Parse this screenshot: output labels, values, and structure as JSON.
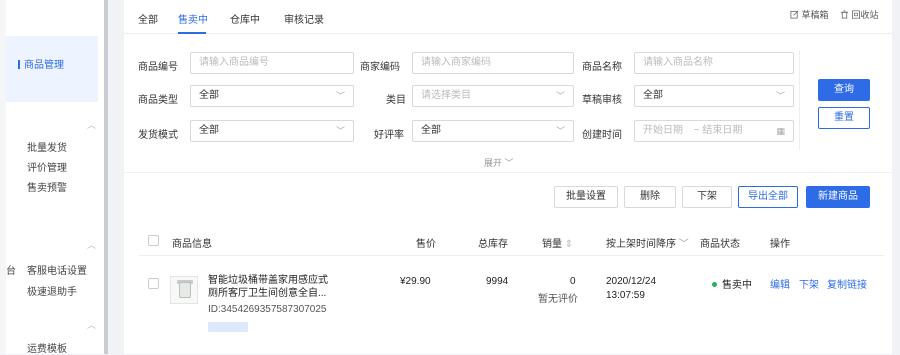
{
  "sidebar": {
    "active_item": "商品管理",
    "group2": [
      "批量发货",
      "评价管理",
      "售卖预警"
    ],
    "group3_cut": "台",
    "group3": [
      "客服电话设置",
      "极速退助手"
    ],
    "group4": [
      "运费模板"
    ]
  },
  "tabs": [
    "全部",
    "售卖中",
    "仓库中",
    "审核记录"
  ],
  "toolbar": {
    "drafts": "草稿箱",
    "recycle": "回收站"
  },
  "filters": {
    "product_code": {
      "label": "商品编号",
      "placeholder": "请输入商品编号"
    },
    "merchant_code": {
      "label": "商家编码",
      "placeholder": "请输入商家编码"
    },
    "product_name": {
      "label": "商品名称",
      "placeholder": "请输入商品名称"
    },
    "product_type": {
      "label": "商品类型",
      "value": "全部"
    },
    "category": {
      "label": "类目",
      "placeholder": "请选择类目"
    },
    "draft_review": {
      "label": "草稿审核",
      "value": "全部"
    },
    "ship_mode": {
      "label": "发货模式",
      "value": "全部"
    },
    "rating": {
      "label": "好评率",
      "value": "全部"
    },
    "created": {
      "label": "创建时间",
      "start": "开始日期",
      "sep": "~",
      "end": "结束日期"
    }
  },
  "buttons": {
    "query": "查询",
    "reset": "重置",
    "expand": "展开",
    "batch": "批量设置",
    "delete": "删除",
    "offshelf": "下架",
    "export_all": "导出全部",
    "new_product": "新建商品"
  },
  "table": {
    "headers": {
      "info": "商品信息",
      "price": "售价",
      "stock": "总库存",
      "sales": "销量",
      "time": "按上架时间降序",
      "status": "商品状态",
      "ops": "操作"
    },
    "rows": [
      {
        "name": "智能垃圾桶带盖家用感应式厕所客厅卫生间创意全自...",
        "name_line1": "智能垃圾桶带盖家用感应式",
        "name_line2": "厕所客厅卫生间创意全自...",
        "id": "ID:3454269357587307025",
        "price": "¥29.90",
        "stock": "9994",
        "sales": "0",
        "rating_note": "暂无评价",
        "date": "2020/12/24",
        "time": "13:07:59",
        "status": "售卖中",
        "ops": [
          "编辑",
          "下架",
          "复制链接"
        ]
      }
    ]
  },
  "colors": {
    "primary": "#2e6be6",
    "success": "#22b35e"
  }
}
